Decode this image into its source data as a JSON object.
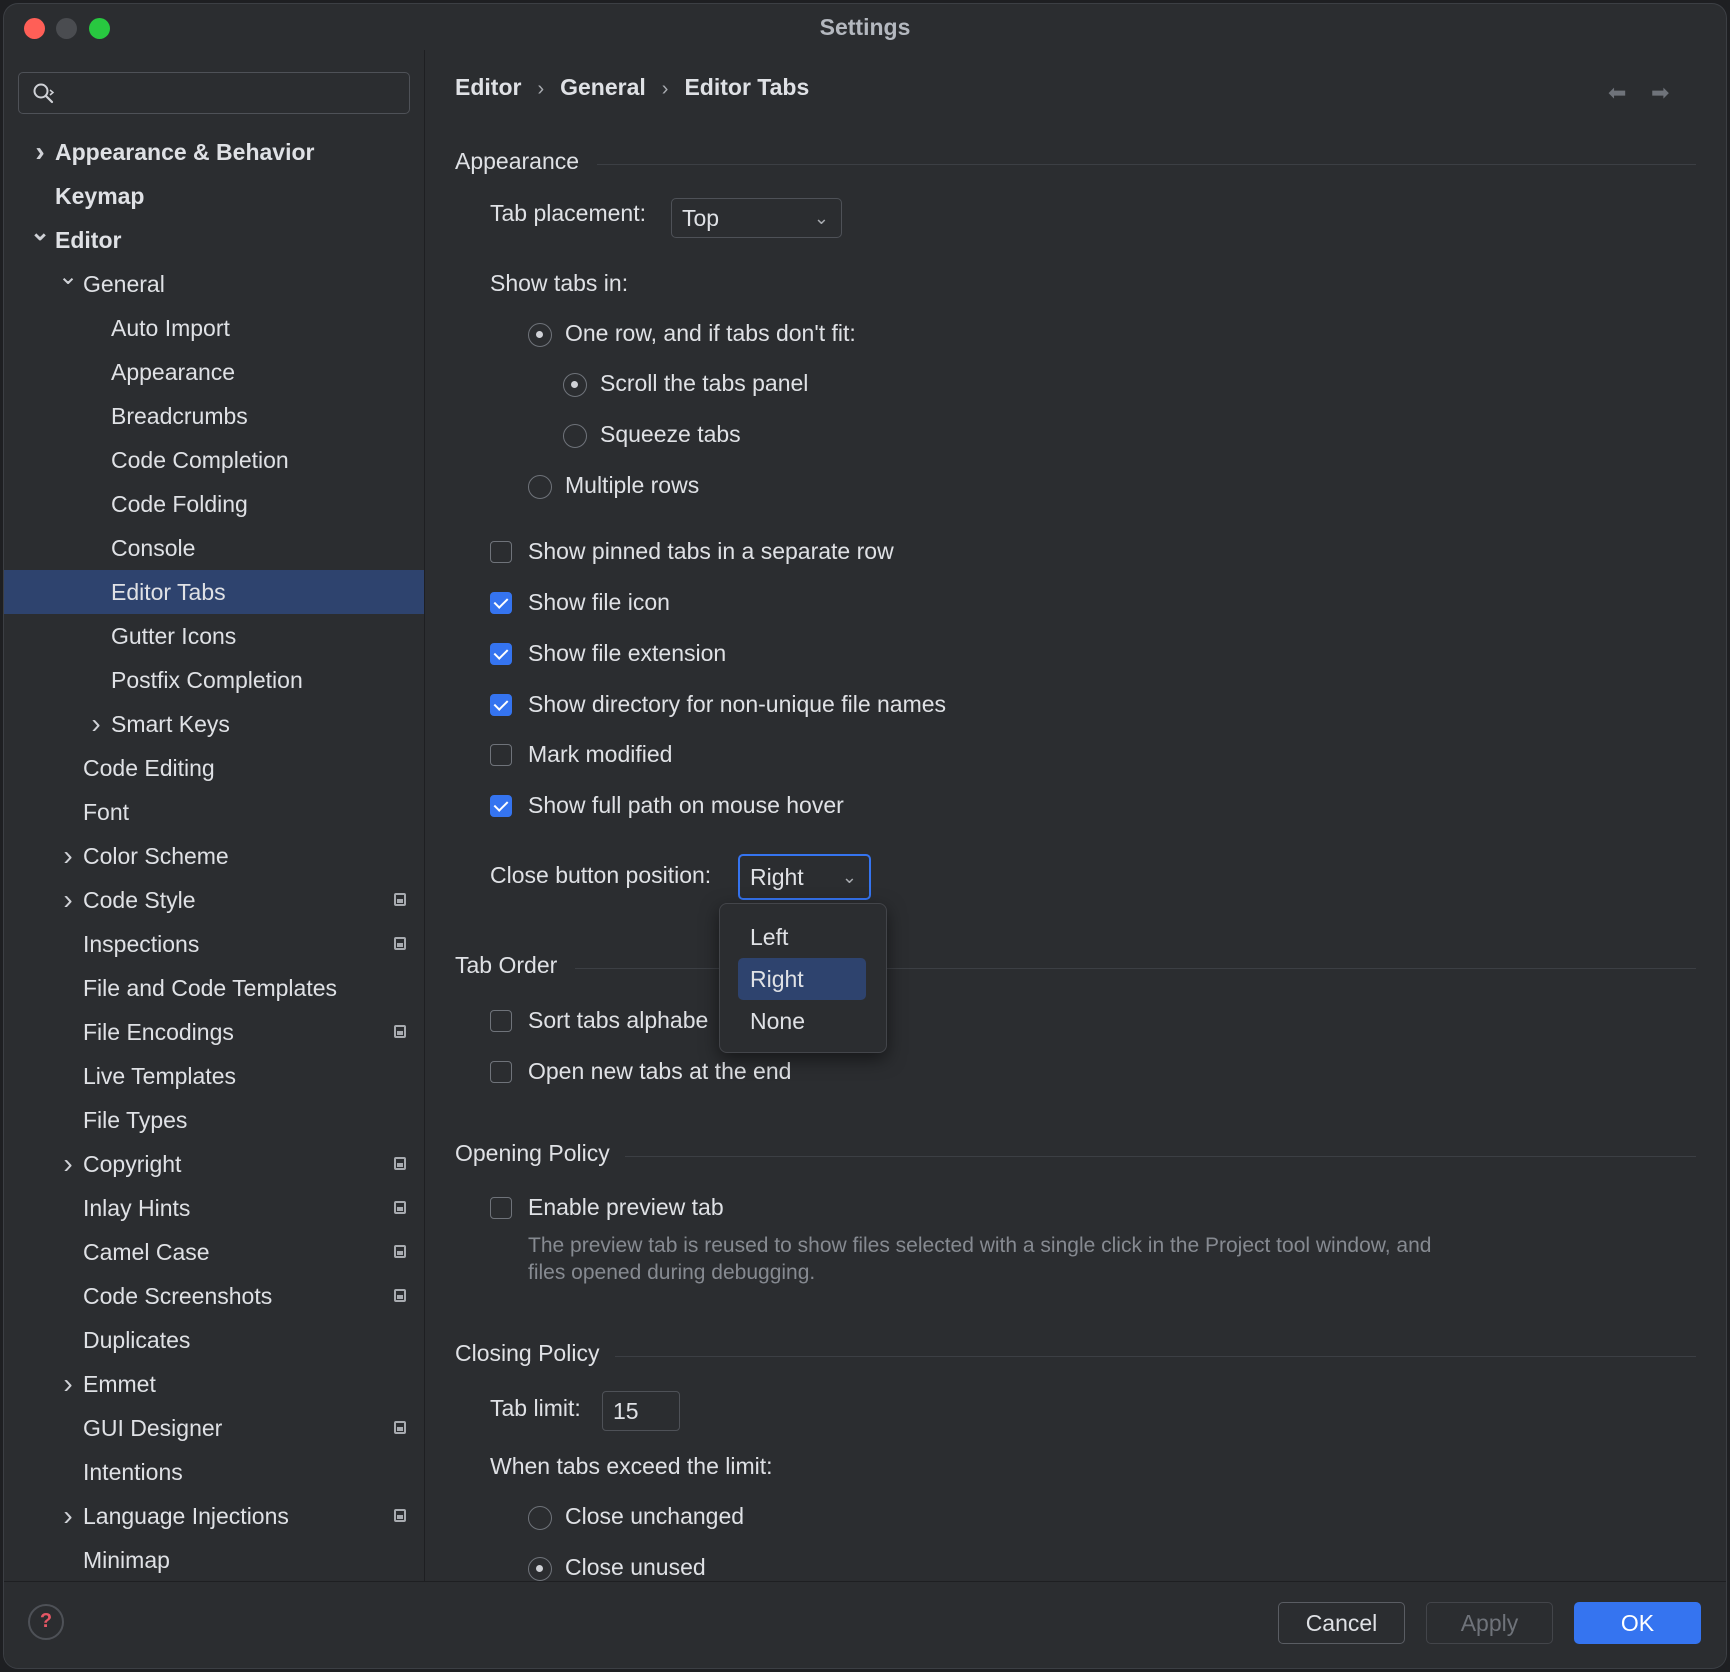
{
  "window": {
    "title": "Settings"
  },
  "search": {
    "value": "",
    "placeholder": ""
  },
  "sidebar": {
    "items": [
      {
        "label": "Appearance & Behavior",
        "level": 0,
        "chevron": "right",
        "bold": true
      },
      {
        "label": "Keymap",
        "level": 0,
        "chevron": "",
        "bold": true
      },
      {
        "label": "Editor",
        "level": 0,
        "chevron": "down",
        "bold": true
      },
      {
        "label": "General",
        "level": 1,
        "chevron": "down"
      },
      {
        "label": "Auto Import",
        "level": 2,
        "chevron": ""
      },
      {
        "label": "Appearance",
        "level": 2,
        "chevron": ""
      },
      {
        "label": "Breadcrumbs",
        "level": 2,
        "chevron": ""
      },
      {
        "label": "Code Completion",
        "level": 2,
        "chevron": ""
      },
      {
        "label": "Code Folding",
        "level": 2,
        "chevron": ""
      },
      {
        "label": "Console",
        "level": 2,
        "chevron": ""
      },
      {
        "label": "Editor Tabs",
        "level": 2,
        "chevron": "",
        "selected": true
      },
      {
        "label": "Gutter Icons",
        "level": 2,
        "chevron": ""
      },
      {
        "label": "Postfix Completion",
        "level": 2,
        "chevron": ""
      },
      {
        "label": "Smart Keys",
        "level": 2,
        "chevron": "right"
      },
      {
        "label": "Code Editing",
        "level": 1,
        "chevron": ""
      },
      {
        "label": "Font",
        "level": 1,
        "chevron": ""
      },
      {
        "label": "Color Scheme",
        "level": 1,
        "chevron": "right"
      },
      {
        "label": "Code Style",
        "level": 1,
        "chevron": "right",
        "project": true
      },
      {
        "label": "Inspections",
        "level": 1,
        "chevron": "",
        "project": true
      },
      {
        "label": "File and Code Templates",
        "level": 1,
        "chevron": ""
      },
      {
        "label": "File Encodings",
        "level": 1,
        "chevron": "",
        "project": true
      },
      {
        "label": "Live Templates",
        "level": 1,
        "chevron": ""
      },
      {
        "label": "File Types",
        "level": 1,
        "chevron": ""
      },
      {
        "label": "Copyright",
        "level": 1,
        "chevron": "right",
        "project": true
      },
      {
        "label": "Inlay Hints",
        "level": 1,
        "chevron": "",
        "project": true
      },
      {
        "label": "Camel Case",
        "level": 1,
        "chevron": "",
        "project": true
      },
      {
        "label": "Code Screenshots",
        "level": 1,
        "chevron": "",
        "project": true
      },
      {
        "label": "Duplicates",
        "level": 1,
        "chevron": ""
      },
      {
        "label": "Emmet",
        "level": 1,
        "chevron": "right"
      },
      {
        "label": "GUI Designer",
        "level": 1,
        "chevron": "",
        "project": true
      },
      {
        "label": "Intentions",
        "level": 1,
        "chevron": ""
      },
      {
        "label": "Language Injections",
        "level": 1,
        "chevron": "right",
        "project": true
      },
      {
        "label": "Minimap",
        "level": 1,
        "chevron": ""
      }
    ]
  },
  "breadcrumb": {
    "items": [
      "Editor",
      "General",
      "Editor Tabs"
    ]
  },
  "appearance": {
    "title": "Appearance",
    "tab_placement_label": "Tab placement:",
    "tab_placement_value": "Top",
    "show_tabs_in_label": "Show tabs in:",
    "one_row_label": "One row, and if tabs don't fit:",
    "scroll_label": "Scroll the tabs panel",
    "squeeze_label": "Squeeze tabs",
    "multiple_rows_label": "Multiple rows",
    "pinned_separate_label": "Show pinned tabs in a separate row",
    "show_file_icon_label": "Show file icon",
    "show_file_extension_label": "Show file extension",
    "show_directory_label": "Show directory for non-unique file names",
    "mark_modified_label": "Mark modified",
    "show_full_path_label": "Show full path on mouse hover",
    "close_button_position_label": "Close button position:",
    "close_button_position_value": "Right",
    "close_button_options": [
      "Left",
      "Right",
      "None"
    ]
  },
  "tab_order": {
    "title": "Tab Order",
    "sort_alpha_label": "Sort tabs alphabe",
    "open_at_end_label": "Open new tabs at the end"
  },
  "opening_policy": {
    "title": "Opening Policy",
    "preview_tab_label": "Enable preview tab",
    "preview_hint_line1": "The preview tab is reused to show files selected with a single click in the Project tool window, and",
    "preview_hint_line2": "files opened during debugging."
  },
  "closing_policy": {
    "title": "Closing Policy",
    "tab_limit_label": "Tab limit:",
    "tab_limit_value": "15",
    "exceed_label": "When tabs exceed the limit:",
    "close_unchanged_label": "Close unchanged",
    "close_unused_label": "Close unused"
  },
  "footer": {
    "cancel": "Cancel",
    "apply": "Apply",
    "ok": "OK"
  },
  "colors": {
    "accent": "#3574f0",
    "selection": "#2e436e",
    "background": "#2b2d30"
  }
}
